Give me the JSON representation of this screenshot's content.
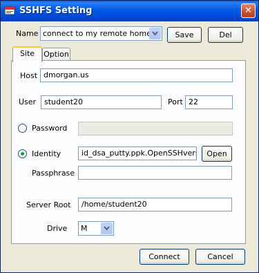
{
  "window": {
    "title": "SSHFS Setting",
    "close_glyph": "✕"
  },
  "name_row": {
    "label": "Name",
    "value": "connect to my remote home",
    "save_label": "Save",
    "del_label": "Del"
  },
  "tabs": [
    {
      "label": "Site"
    },
    {
      "label": "Option"
    }
  ],
  "site": {
    "host_label": "Host",
    "host_value": "dmorgan.us",
    "user_label": "User",
    "user_value": "student20",
    "port_label": "Port",
    "port_value": "22",
    "password_label": "Password",
    "password_value": "",
    "identity_label": "Identity",
    "identity_value": "id_dsa_putty.ppk.OpenSSHversion",
    "open_label": "Open",
    "passphrase_label": "Passphrase",
    "passphrase_value": "",
    "server_root_label": "Server Root",
    "server_root_value": "/home/student20",
    "drive_label": "Drive",
    "drive_value": "M",
    "selected_auth": "identity"
  },
  "footer": {
    "connect_label": "Connect",
    "cancel_label": "Cancel"
  },
  "colors": {
    "title_bar": "#0058e6",
    "window_bg": "#ece9d8",
    "close_button": "#c8502c",
    "radio_selected": "#21a121"
  }
}
